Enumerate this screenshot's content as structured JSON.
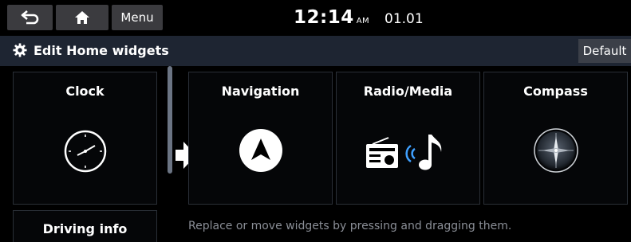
{
  "topbar": {
    "menu_label": "Menu",
    "time": "12:14",
    "ampm": "AM",
    "date": "01.01",
    "back_icon": "back-arrow-icon",
    "home_icon": "home-icon"
  },
  "titlebar": {
    "title": "Edit Home widgets",
    "default_label": "Default",
    "icon": "gear-icon"
  },
  "widgets_list": [
    {
      "label": "Clock",
      "icon": "clock-icon"
    },
    {
      "label": "Driving info"
    }
  ],
  "widget_slots": [
    {
      "label": "Navigation",
      "icon": "navigation-icon"
    },
    {
      "label": "Radio/Media",
      "icon": "radio-media-icon"
    },
    {
      "label": "Compass",
      "icon": "compass-icon"
    }
  ],
  "hint": "Replace or move widgets by pressing and dragging them."
}
